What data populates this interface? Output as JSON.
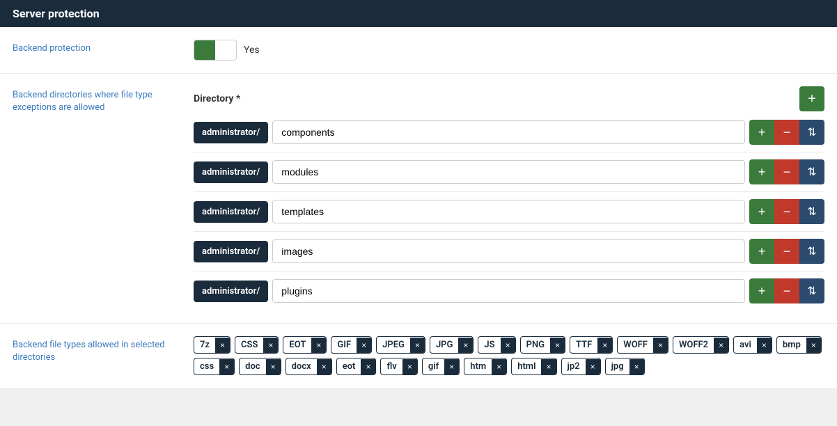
{
  "header": {
    "title": "Server protection"
  },
  "backend_protection": {
    "label": "Backend protection",
    "toggle_state": "on",
    "toggle_yes_label": "Yes"
  },
  "backend_directories": {
    "label": "Backend directories where file type exceptions are allowed",
    "directory_column_label": "Directory *",
    "add_button_label": "+",
    "rows": [
      {
        "prefix": "administrator/",
        "value": "components"
      },
      {
        "prefix": "administrator/",
        "value": "modules"
      },
      {
        "prefix": "administrator/",
        "value": "templates"
      },
      {
        "prefix": "administrator/",
        "value": "images"
      },
      {
        "prefix": "administrator/",
        "value": "plugins"
      }
    ]
  },
  "backend_filetypes": {
    "label": "Backend file types allowed in selected directories",
    "tags": [
      "7z",
      "CSS",
      "EOT",
      "GIF",
      "JPEG",
      "JPG",
      "JS",
      "PNG",
      "TTF",
      "WOFF",
      "WOFF2",
      "avi",
      "bmp",
      "css",
      "doc",
      "docx",
      "eot",
      "flv",
      "gif",
      "htm",
      "html",
      "jp2",
      "jpg"
    ]
  },
  "icons": {
    "plus": "+",
    "minus": "−",
    "move": "⇅",
    "close": "×"
  }
}
